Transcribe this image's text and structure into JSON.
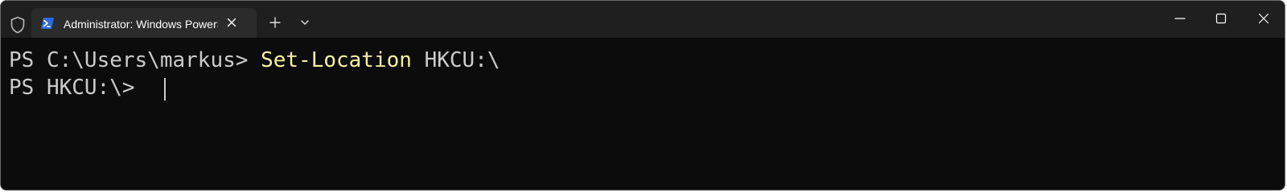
{
  "titlebar": {
    "tab": {
      "title": "Administrator: Windows PowerShell",
      "icon": "powershell-icon"
    },
    "admin_icon": "shield-icon",
    "new_tab_icon": "plus-icon",
    "dropdown_icon": "chevron-down-icon",
    "window_controls": [
      "minimize-icon",
      "maximize-icon",
      "close-icon"
    ]
  },
  "terminal": {
    "lines": [
      {
        "prompt": "PS C:\\Users\\markus> ",
        "command": "Set-Location",
        "argument": " HKCU:\\"
      },
      {
        "prompt": "PS HKCU:\\> ",
        "command": "",
        "argument": ""
      }
    ],
    "colors": {
      "background": "#0c0c0c",
      "text": "#cccccc",
      "command": "#f9f1a5",
      "titlebar": "#1f1f1f",
      "tab": "#2b2b2b"
    }
  }
}
